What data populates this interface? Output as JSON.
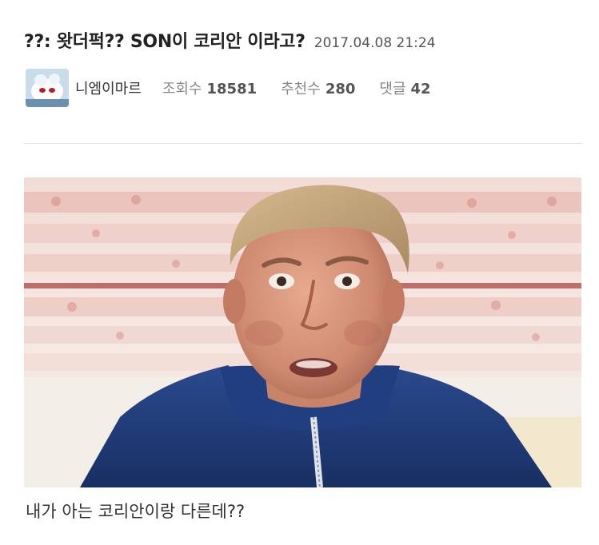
{
  "post": {
    "title": "??: 왓더퍽?? SON이 코리안 이라고?",
    "date": "2017.04.08 21:24"
  },
  "meta": {
    "author": "니엠이마르",
    "views_label": "조회수",
    "views": "18581",
    "likes_label": "추천수",
    "likes": "280",
    "comments_label": "댓글",
    "comments": "42"
  },
  "content": {
    "caption": "내가 아는 코리안이랑 다른데??"
  },
  "colors": {
    "title_text": "#222222",
    "meta_label": "#888888",
    "meta_value": "#555555",
    "jacket": "#1f3c7c"
  }
}
